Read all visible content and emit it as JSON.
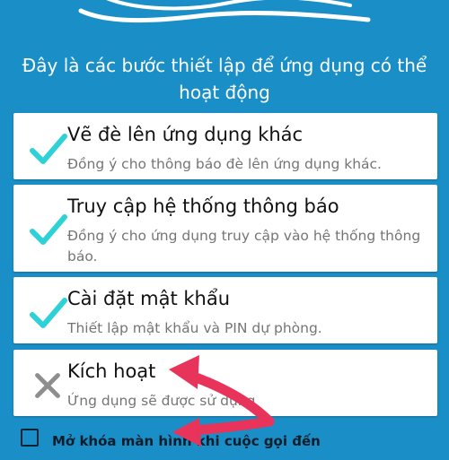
{
  "intro_text": "Đây là các bước thiết lập để ứng dụng có thể hoạt động",
  "steps": [
    {
      "title": "Vẽ đè lên ứng dụng khác",
      "desc": "Đồng ý cho thông báo đè lên ứng dụng khác.",
      "status": "done"
    },
    {
      "title": "Truy cập hệ thống thông báo",
      "desc": "Đồng ý cho ứng dụng truy cập vào hệ thống thông báo.",
      "status": "done"
    },
    {
      "title": "Cài đặt mật khẩu",
      "desc": "Thiết lập mật khẩu và PIN dự phòng.",
      "status": "done"
    },
    {
      "title": "Kích hoạt",
      "desc": "Ứng dụng sẽ được sử dụng",
      "status": "pending"
    }
  ],
  "unlock_option": {
    "label": "Mở khóa màn hình khi cuộc gọi đến",
    "checked": false
  },
  "colors": {
    "background": "#1a8fc7",
    "check": "#2ed2d6",
    "cross": "#8e8e8e",
    "annotation_arrow": "#e8345a"
  }
}
